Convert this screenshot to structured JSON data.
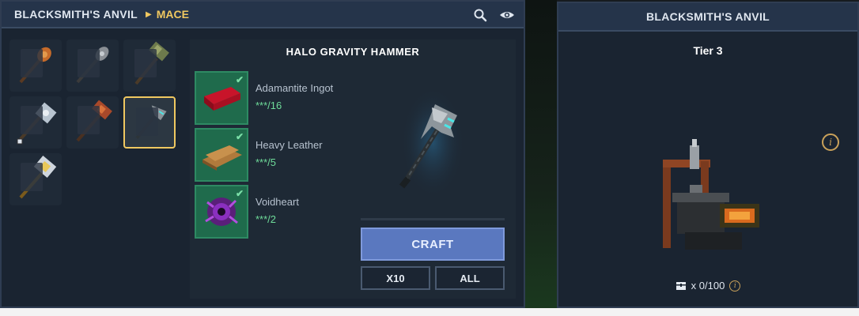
{
  "header": {
    "breadcrumb_root": "BLACKSMITH'S ANVIL",
    "breadcrumb_current": "MACE",
    "icons": [
      "search-icon",
      "eye-icon"
    ]
  },
  "grid": {
    "items": [
      {
        "name": "spiked-mace-icon"
      },
      {
        "name": "iron-mace-icon"
      },
      {
        "name": "moss-hammer-icon"
      },
      {
        "name": "double-axe-mace-icon"
      },
      {
        "name": "rust-hammer-icon"
      },
      {
        "name": "halo-gravity-hammer-icon",
        "selected": true
      },
      {
        "name": "golden-warhammer-icon"
      }
    ]
  },
  "recipe": {
    "title": "HALO GRAVITY HAMMER",
    "ingredients": [
      {
        "name": "Adamantite Ingot",
        "qty": "***/16",
        "icon": "ingot-icon"
      },
      {
        "name": "Heavy Leather",
        "qty": "***/5",
        "icon": "leather-icon"
      },
      {
        "name": "Voidheart",
        "qty": "***/2",
        "icon": "voidheart-icon"
      }
    ],
    "craft_label": "CRAFT",
    "x10_label": "X10",
    "all_label": "ALL"
  },
  "station": {
    "title": "BLACKSMITH'S ANVIL",
    "tier": "Tier 3",
    "storage": "x 0/100",
    "colors": {
      "accent": "#f0c860",
      "craft": "#5a78bf",
      "ingredient_ok": "#1f6b4c"
    }
  }
}
